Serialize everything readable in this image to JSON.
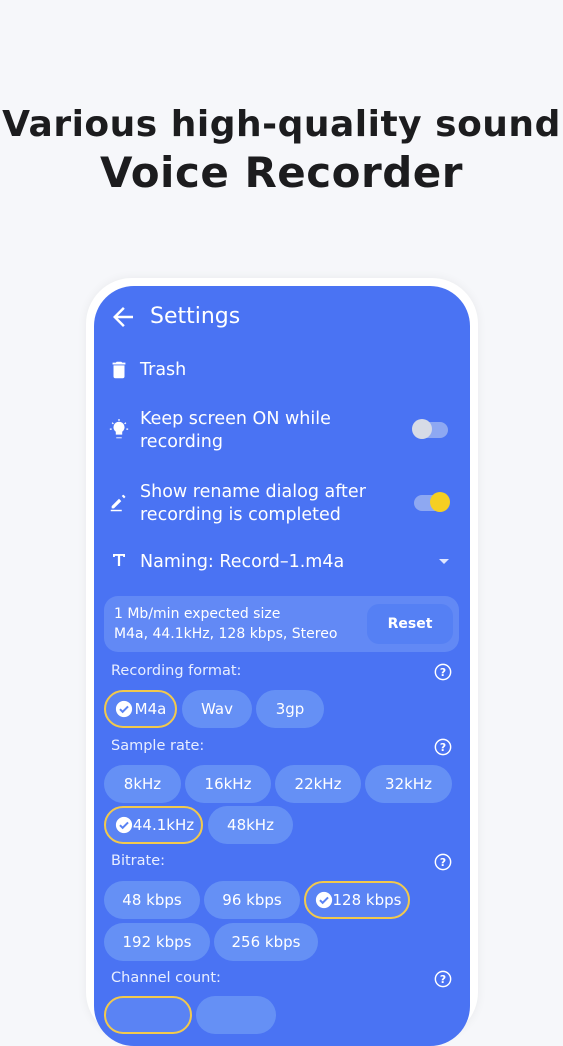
{
  "headline": {
    "line1": "Various high-quality sound",
    "line2": "Voice Recorder"
  },
  "settings": {
    "title": "Settings",
    "trash_label": "Trash",
    "keep_screen": {
      "label_1": "Keep screen ON while",
      "label_2": "recording",
      "enabled": false
    },
    "rename_dialog": {
      "label_1": "Show rename dialog after",
      "label_2": "recording is completed",
      "enabled": true
    },
    "naming_label": "Naming: Record–1.m4a",
    "info": {
      "line1": "1 Mb/min expected size",
      "line2": "M4a, 44.1kHz, 128 kbps, Stereo",
      "reset_label": "Reset"
    },
    "recording_format": {
      "label": "Recording format:",
      "options": [
        "M4a",
        "Wav",
        "3gp"
      ],
      "selected": "M4a"
    },
    "sample_rate": {
      "label": "Sample rate:",
      "options": [
        "8kHz",
        "16kHz",
        "22kHz",
        "32kHz",
        "44.1kHz",
        "48kHz"
      ],
      "selected": "44.1kHz"
    },
    "bitrate": {
      "label": "Bitrate:",
      "options": [
        "48 kbps",
        "96 kbps",
        "128 kbps",
        "192 kbps",
        "256 kbps"
      ],
      "selected": "128 kbps"
    },
    "channel_count": {
      "label": "Channel count:"
    }
  },
  "colors": {
    "screen_bg": "#4a73f3",
    "chip_bg": "#6590f5",
    "selected_border": "#f2c94c",
    "toggle_on_knob": "#f5cf22"
  }
}
